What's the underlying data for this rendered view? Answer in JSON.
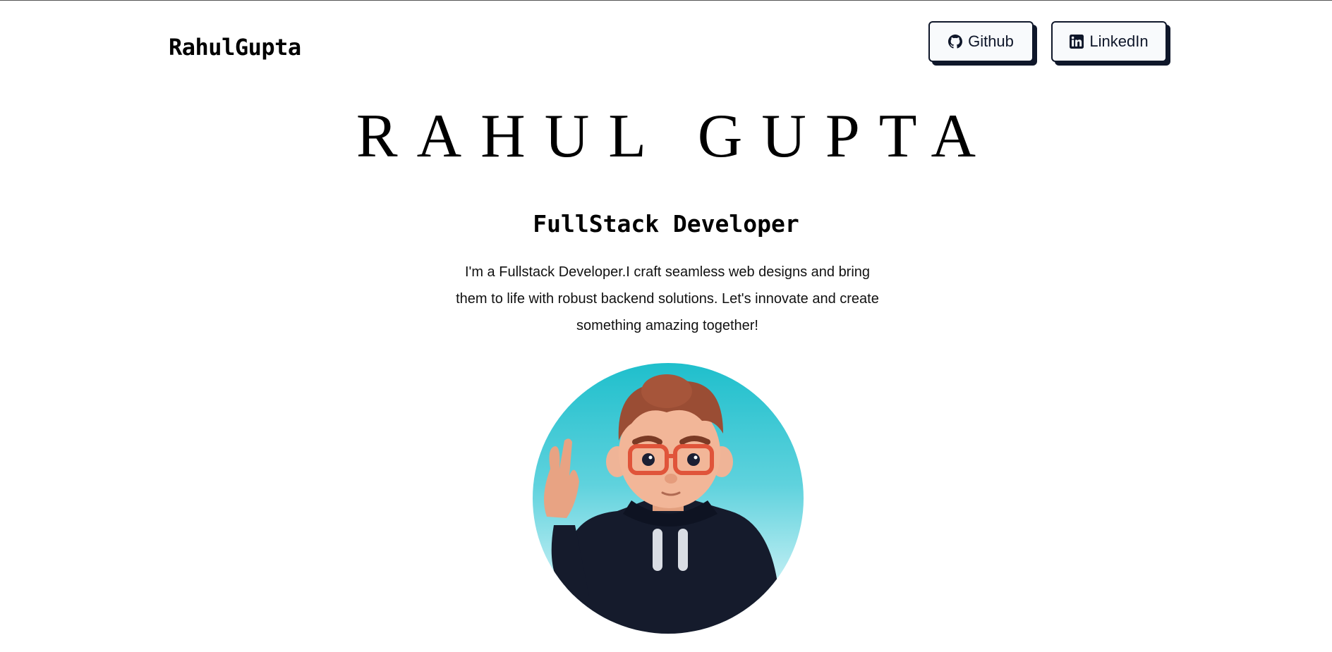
{
  "header": {
    "brand": "RahulGupta",
    "buttons": [
      {
        "label": "Github",
        "icon": "github-icon"
      },
      {
        "label": "LinkedIn",
        "icon": "linkedin-icon"
      }
    ]
  },
  "hero": {
    "name": "RAHUL GUPTA",
    "role": "FullStack Developer",
    "bio": "I'm a Fullstack Developer.I craft seamless web designs and bring them to life with robust backend solutions. Let's innovate and create something amazing together!"
  },
  "colors": {
    "button_border": "#0f172a",
    "button_bg": "#f8fafc",
    "avatar_top": "#1fbfcc",
    "avatar_bottom": "#eefbfd"
  }
}
